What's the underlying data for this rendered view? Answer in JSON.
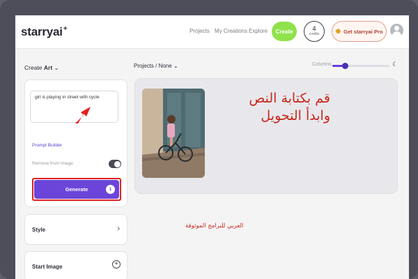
{
  "app": {
    "logo": "starryai"
  },
  "nav": {
    "projects": "Projects",
    "my_creations": "My Creations",
    "explore": "Explore"
  },
  "header": {
    "create_label": "Create",
    "credits_count": "4",
    "credits_label": "credits",
    "pro_label": "Get starryai Pro"
  },
  "toolbar": {
    "create_art": "Create",
    "create_art_bold": "Art",
    "projects_path": "Projects / None",
    "columns_label": "Columns",
    "columns_level": 0.22
  },
  "panel": {
    "prompt_value": "girl is playing in street with cycle",
    "prompt_builder": "Prompt Builder",
    "remove_from_image": "Remove from Image",
    "remove_toggle_on": true,
    "generate_label": "Generate",
    "generate_badge": "1"
  },
  "cards": {
    "style": "Style",
    "start_image": "Start Image"
  },
  "overlay": {
    "title_line1": "قم بكتابة النص",
    "title_line2": "وابدأ التحويل",
    "note": "العربي للبرامج الموثوقة"
  },
  "colors": {
    "accent": "#6b45d9",
    "create_green": "#8fe24c",
    "highlight_red": "#e0201f",
    "arabic_text": "#c8281c"
  },
  "icons": {
    "chevron": "chevron-down-icon",
    "moon": "moon-icon",
    "gear": "gear-icon",
    "plus": "plus-circle-icon",
    "avatar": "user-avatar-icon",
    "arrow": "red-pointer-arrow-icon"
  }
}
